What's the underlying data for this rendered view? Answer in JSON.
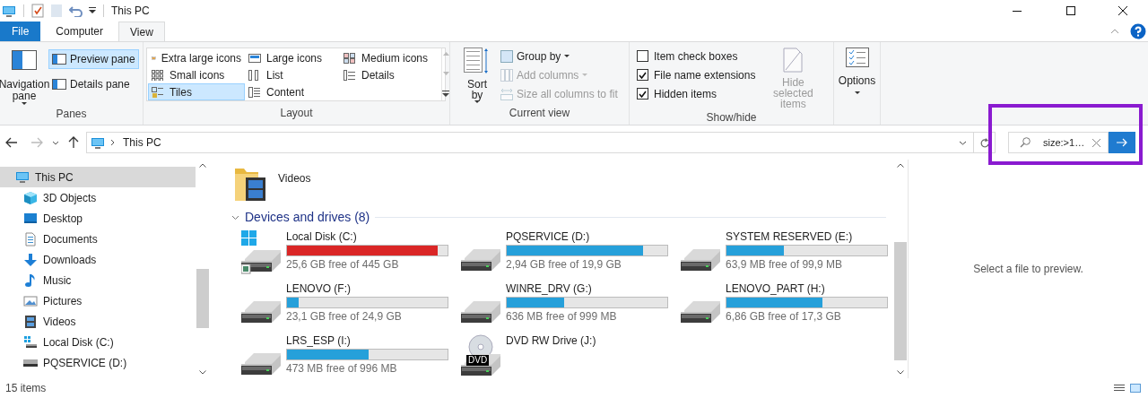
{
  "window": {
    "title": "This PC"
  },
  "tabs": [
    {
      "label": "File",
      "kind": "file",
      "selected": false
    },
    {
      "label": "Computer",
      "kind": "tab",
      "selected": false
    },
    {
      "label": "View",
      "kind": "tab",
      "selected": true
    }
  ],
  "ribbon": {
    "panes": {
      "title": "Panes",
      "navigation_pane": "Navigation pane",
      "buttons": [
        {
          "label": "Preview pane",
          "selected": true
        },
        {
          "label": "Details pane",
          "selected": false
        }
      ]
    },
    "layout": {
      "title": "Layout",
      "options": [
        {
          "label": "Extra large icons",
          "kind": "xl",
          "selected": false
        },
        {
          "label": "Large icons",
          "kind": "large",
          "selected": false
        },
        {
          "label": "Medium icons",
          "kind": "medium",
          "selected": false
        },
        {
          "label": "Small icons",
          "kind": "small",
          "selected": false
        },
        {
          "label": "List",
          "kind": "list",
          "selected": false
        },
        {
          "label": "Details",
          "kind": "details",
          "selected": false
        },
        {
          "label": "Tiles",
          "kind": "tiles",
          "selected": true
        },
        {
          "label": "Content",
          "kind": "content",
          "selected": false
        }
      ]
    },
    "current_view": {
      "title": "Current view",
      "sort_by": "Sort by",
      "commands": [
        {
          "label": "Group by",
          "kind": "group",
          "disabled": false
        },
        {
          "label": "Add columns",
          "kind": "columns",
          "disabled": true
        },
        {
          "label": "Size all columns to fit",
          "kind": "fit",
          "disabled": true
        }
      ]
    },
    "show_hide": {
      "title": "Show/hide",
      "checkboxes": [
        {
          "label": "Item check boxes",
          "checked": false
        },
        {
          "label": "File name extensions",
          "checked": true
        },
        {
          "label": "Hidden items",
          "checked": true
        }
      ],
      "hide_selected": {
        "label": "Hide selected items",
        "disabled": true
      }
    },
    "options": {
      "label": "Options"
    }
  },
  "address_bar": {
    "path": "This PC"
  },
  "search": {
    "value": "size:>1…"
  },
  "sidebar": {
    "items": [
      {
        "label": "This PC",
        "kind": "pc",
        "selected": true,
        "children": [
          {
            "label": "3D Objects",
            "kind": "cube",
            "selected": false
          },
          {
            "label": "Desktop",
            "kind": "desktop",
            "selected": false
          },
          {
            "label": "Documents",
            "kind": "documents",
            "selected": false
          },
          {
            "label": "Downloads",
            "kind": "downloads",
            "selected": false
          },
          {
            "label": "Music",
            "kind": "music",
            "selected": false
          },
          {
            "label": "Pictures",
            "kind": "pictures",
            "selected": false
          },
          {
            "label": "Videos",
            "kind": "videos",
            "selected": false
          },
          {
            "label": "Local Disk (C:)",
            "kind": "system-disk",
            "selected": false
          },
          {
            "label": "PQSERVICE (D:)",
            "kind": "disk",
            "selected": false
          }
        ]
      }
    ]
  },
  "content": {
    "folders": [
      {
        "name": "Videos"
      }
    ],
    "section": {
      "title": "Devices and drives (8)",
      "expanded": true
    },
    "drives": [
      {
        "name": "Local Disk (C:)",
        "kind": "system",
        "free": "25,6 GB free of 445 GB",
        "level": 0.94,
        "color": "#da2626"
      },
      {
        "name": "PQSERVICE (D:)",
        "kind": "hdd",
        "free": "2,94 GB free of 19,9 GB",
        "level": 0.85,
        "color": "#26a0da"
      },
      {
        "name": "SYSTEM RESERVED (E:)",
        "kind": "hdd",
        "free": "63,9 MB free of 99,9 MB",
        "level": 0.36,
        "color": "#26a0da"
      },
      {
        "name": "LENOVO (F:)",
        "kind": "hdd",
        "free": "23,1 GB free of 24,9 GB",
        "level": 0.07,
        "color": "#26a0da"
      },
      {
        "name": "WINRE_DRV (G:)",
        "kind": "hdd",
        "free": "636 MB free of 999 MB",
        "level": 0.36,
        "color": "#26a0da"
      },
      {
        "name": "LENOVO_PART (H:)",
        "kind": "hdd",
        "free": "6,86 GB free of 17,3 GB",
        "level": 0.6,
        "color": "#26a0da"
      },
      {
        "name": "LRS_ESP (I:)",
        "kind": "hdd",
        "free": "473 MB free of 996 MB",
        "level": 0.51,
        "color": "#26a0da"
      },
      {
        "name": "DVD RW Drive (J:)",
        "kind": "dvd",
        "badge": "DVD"
      }
    ]
  },
  "preview": {
    "message": "Select a file to preview."
  },
  "status_bar": {
    "count": "15 items"
  }
}
